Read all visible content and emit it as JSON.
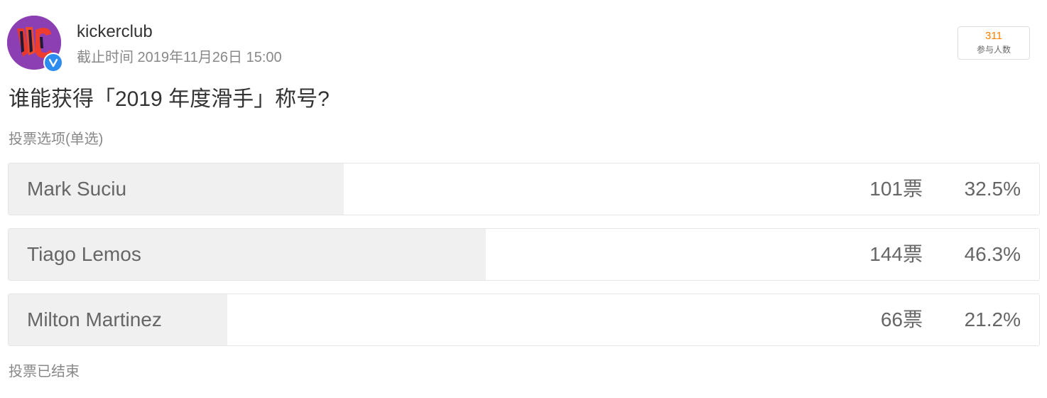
{
  "poster": {
    "username": "kickerclub",
    "avatar_icon": "kickerclub-logo-avatar",
    "verified_icon": "verified-badge-icon",
    "deadline": "截止时间 2019年11月26日 15:00"
  },
  "participants": {
    "count": "311",
    "label": "参与人数"
  },
  "poll": {
    "question": "谁能获得「2019 年度滑手」称号?",
    "vote_type": "投票选项(单选)",
    "options": [
      {
        "name": "Mark Suciu",
        "votes": "101票",
        "percent": "32.5%",
        "share": 0.325
      },
      {
        "name": "Tiago Lemos",
        "votes": "144票",
        "percent": "46.3%",
        "share": 0.463
      },
      {
        "name": "Milton Martinez",
        "votes": "66票",
        "percent": "21.2%",
        "share": 0.212
      }
    ],
    "status": "投票已结束"
  },
  "colors": {
    "accent_count": "#ff8200",
    "verified": "#2d8cf0",
    "bar_fill": "#f0f0f0"
  }
}
